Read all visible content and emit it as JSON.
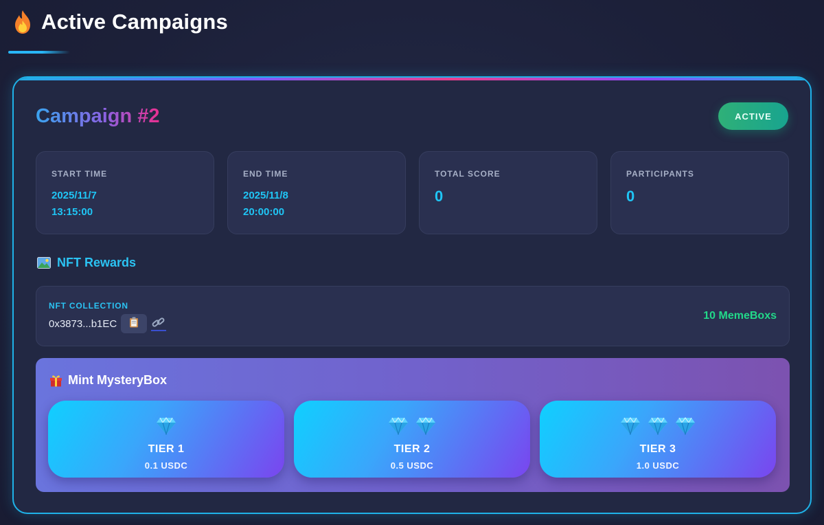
{
  "header": {
    "title": "Active Campaigns",
    "icon": "fire-icon"
  },
  "campaign": {
    "title": "Campaign #2",
    "status": "ACTIVE",
    "stats": [
      {
        "label": "START TIME",
        "line1": "2025/11/7",
        "line2": "13:15:00"
      },
      {
        "label": "END TIME",
        "line1": "2025/11/8",
        "line2": "20:00:00"
      },
      {
        "label": "TOTAL SCORE",
        "value": "0"
      },
      {
        "label": "PARTICIPANTS",
        "value": "0"
      }
    ]
  },
  "nft_rewards": {
    "heading": "NFT Rewards",
    "icon": "picture-icon",
    "collection_label": "NFT COLLECTION",
    "address": "0x3873...b1EC",
    "count": "10 MemeBoxs"
  },
  "mint": {
    "heading": "Mint MysteryBox",
    "icon": "gift-icon",
    "tiers": [
      {
        "name": "TIER 1",
        "price": "0.1 USDC",
        "gems": 1
      },
      {
        "name": "TIER 2",
        "price": "0.5 USDC",
        "gems": 2
      },
      {
        "name": "TIER 3",
        "price": "1.0 USDC",
        "gems": 3
      }
    ]
  },
  "colors": {
    "accent": "#1fb2e8",
    "value": "#1fc5f5",
    "success": "#22d889",
    "badge": "#2fb078"
  }
}
